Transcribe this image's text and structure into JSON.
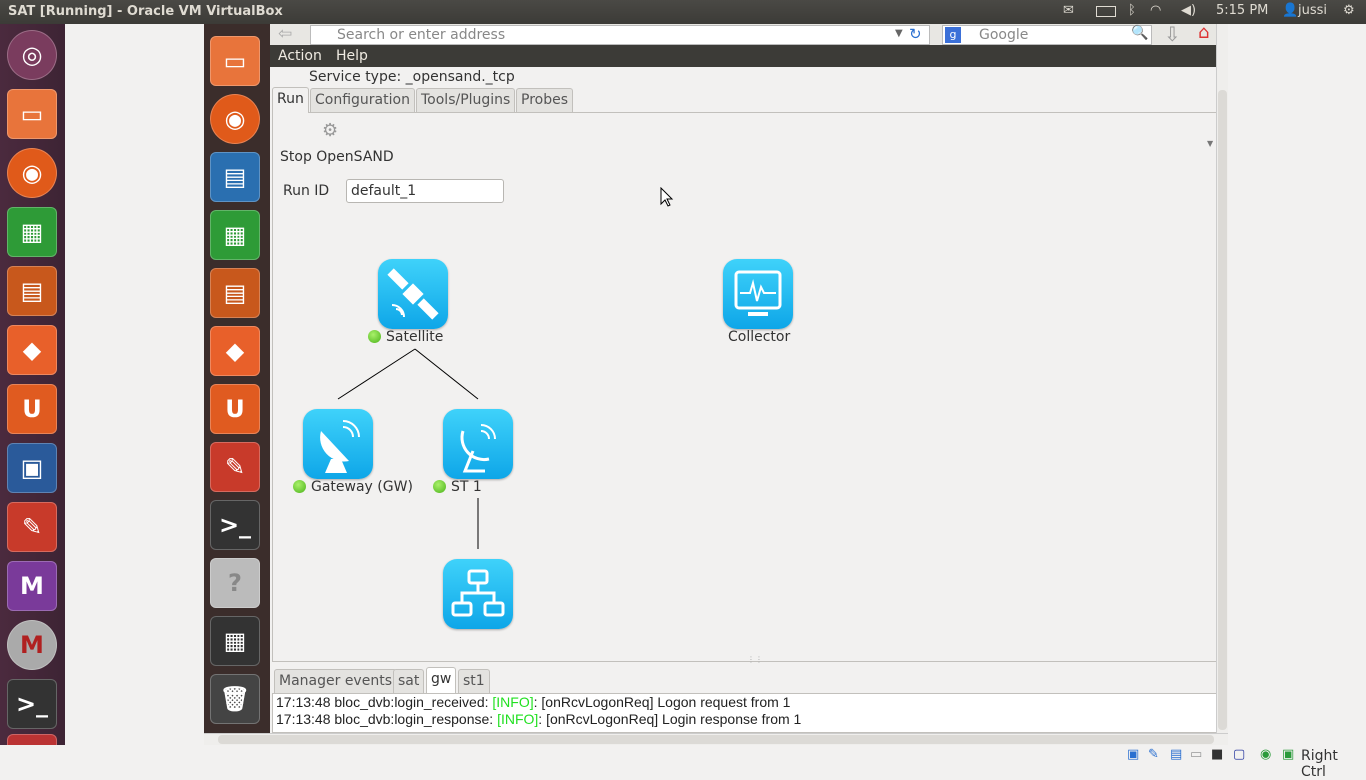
{
  "window": {
    "title": "SAT [Running] - Oracle VM VirtualBox"
  },
  "topbar": {
    "time": "5:15 PM",
    "user": "jussi",
    "icons": [
      "mail-icon",
      "battery-icon",
      "bluetooth-icon",
      "wifi-icon",
      "volume-icon",
      "user-icon",
      "power-icon"
    ]
  },
  "browser": {
    "address_placeholder": "Search or enter address",
    "search_placeholder": "Google"
  },
  "menu": {
    "items": [
      "Action",
      "Help"
    ]
  },
  "app": {
    "service_type": "Service type: _opensand._tcp",
    "tabs": [
      "Run",
      "Configuration",
      "Tools/Plugins",
      "Probes"
    ],
    "stop_label": "Stop OpenSAND",
    "run_id_label": "Run ID",
    "run_id_value": "default_1",
    "nodes": {
      "satellite": "Satellite",
      "collector": "Collector",
      "gateway": "Gateway (GW)",
      "st1": "ST 1"
    },
    "status_color": "#4bb31a"
  },
  "log": {
    "tabs": [
      "Manager events",
      "sat",
      "gw",
      "st1"
    ],
    "active_tab": "gw",
    "lines": [
      {
        "prefix": "17:13:48 bloc_dvb:login_received: ",
        "level": "[INFO]",
        "suffix": ": [onRcvLogonReq] Logon request from 1"
      },
      {
        "prefix": "17:13:48 bloc_dvb:login_response: ",
        "level": "[INFO]",
        "suffix": ": [onRcvLogonReq] Login response from 1"
      }
    ]
  },
  "statusbar": {
    "host_key": "Right Ctrl"
  }
}
